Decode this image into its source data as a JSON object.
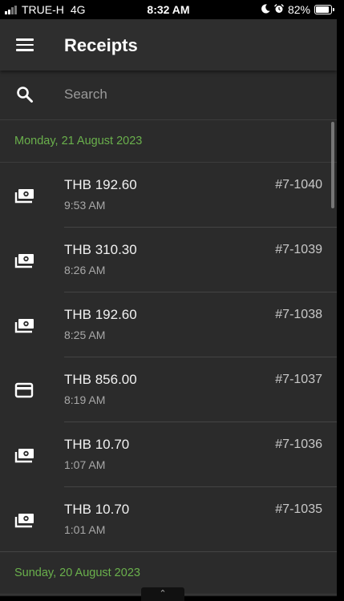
{
  "status_bar": {
    "carrier": "TRUE-H",
    "network": "4G",
    "time": "8:32 AM",
    "battery": "82%"
  },
  "app_bar": {
    "title": "Receipts",
    "menu_icon": "hamburger-menu-icon"
  },
  "search": {
    "placeholder": "Search",
    "icon": "search-icon"
  },
  "groups": [
    {
      "date": "Monday, 21 August 2023",
      "receipts": [
        {
          "amount": "THB 192.60",
          "time": "9:53 AM",
          "number": "#7-1040",
          "payment_icon": "cash-icon"
        },
        {
          "amount": "THB 310.30",
          "time": "8:26 AM",
          "number": "#7-1039",
          "payment_icon": "cash-icon"
        },
        {
          "amount": "THB 192.60",
          "time": "8:25 AM",
          "number": "#7-1038",
          "payment_icon": "cash-icon"
        },
        {
          "amount": "THB 856.00",
          "time": "8:19 AM",
          "number": "#7-1037",
          "payment_icon": "card-icon"
        },
        {
          "amount": "THB 10.70",
          "time": "1:07 AM",
          "number": "#7-1036",
          "payment_icon": "cash-icon"
        },
        {
          "amount": "THB 10.70",
          "time": "1:01 AM",
          "number": "#7-1035",
          "payment_icon": "cash-icon"
        }
      ]
    },
    {
      "date": "Sunday, 20 August 2023",
      "receipts": []
    }
  ],
  "colors": {
    "accent_green": "#6ab04c",
    "background": "#2b2b2b",
    "app_bar": "#2e2e2e"
  }
}
